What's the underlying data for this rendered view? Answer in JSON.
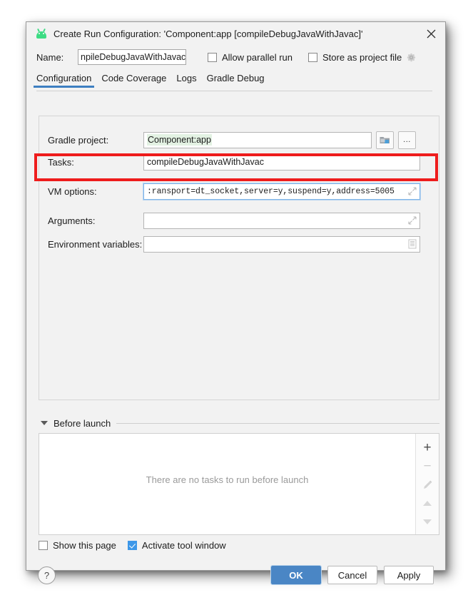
{
  "window": {
    "title": "Create Run Configuration: 'Component:app [compileDebugJavaWithJavac]'",
    "app_icon": "android-robot-icon",
    "close_icon": "close-icon"
  },
  "name_row": {
    "label": "Name:",
    "value": "npileDebugJavaWithJavac]",
    "allow_parallel_run": {
      "label": "Allow parallel run",
      "checked": false
    },
    "store_as_project_file": {
      "label": "Store as project file",
      "checked": false
    },
    "gear_icon": "gear-icon"
  },
  "tabs": [
    {
      "label": "Configuration",
      "active": true
    },
    {
      "label": "Code Coverage",
      "active": false
    },
    {
      "label": "Logs",
      "active": false
    },
    {
      "label": "Gradle Debug",
      "active": false
    }
  ],
  "fields": {
    "gradle_project": {
      "label": "Gradle project:",
      "value": "Component:app",
      "folder_button_icon": "folder-icon",
      "browse_button_label": "..."
    },
    "tasks": {
      "label": "Tasks:",
      "value": "compileDebugJavaWithJavac"
    },
    "vm_options": {
      "label": "VM options:",
      "value": ":ransport=dt_socket,server=y,suspend=y,address=5005",
      "expand_icon": "expand-icon",
      "focused": true,
      "highlight_color": "#ee1c1c"
    },
    "arguments": {
      "label": "Arguments:",
      "value": "",
      "expand_icon": "expand-icon"
    },
    "environment_variables": {
      "label": "Environment variables:",
      "value": "",
      "list_icon": "document-list-icon"
    }
  },
  "before_launch": {
    "title": "Before launch",
    "collapse_icon": "chevron-down-icon",
    "empty_message": "There are no tasks to run before launch",
    "toolbar": {
      "add": "+",
      "remove": "−",
      "edit_icon": "pencil-icon",
      "move_up_icon": "arrow-up-icon",
      "move_down_icon": "arrow-down-icon"
    }
  },
  "footer": {
    "show_this_page": {
      "label": "Show this page",
      "checked": false
    },
    "activate_tool_window": {
      "label": "Activate tool window",
      "checked": true
    },
    "help_label": "?",
    "ok_label": "OK",
    "cancel_label": "Cancel",
    "apply_label": "Apply",
    "accent_color": "#4a86c5"
  }
}
